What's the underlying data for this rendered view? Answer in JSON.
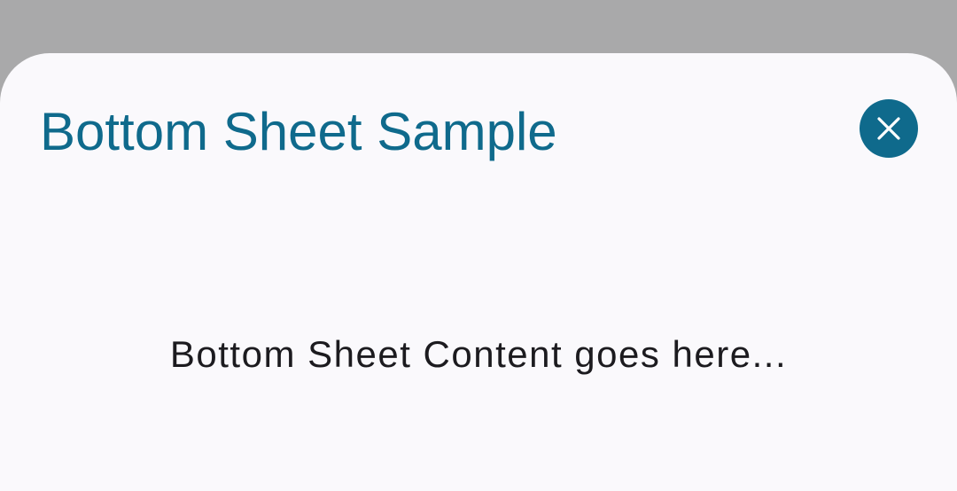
{
  "bottom_sheet": {
    "title": "Bottom Sheet Sample",
    "content": "Bottom Sheet Content goes here...",
    "close_icon": "close-icon"
  },
  "colors": {
    "scrim": "#a9a9aa",
    "sheet_background": "#faf9fc",
    "accent": "#0f6a8c",
    "body_text": "#1c1b1f"
  }
}
